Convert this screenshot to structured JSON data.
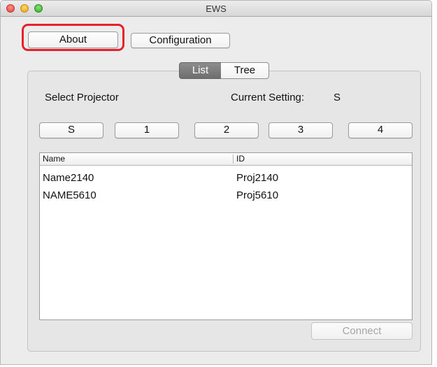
{
  "window": {
    "title": "EWS"
  },
  "toolbar": {
    "about_label": "About",
    "configuration_label": "Configuration"
  },
  "view_switch": {
    "options": [
      "List",
      "Tree"
    ],
    "selected": "List"
  },
  "select_projector": {
    "label": "Select Projector",
    "current_setting_label": "Current Setting:",
    "current_setting_value": "S",
    "buttons": [
      "S",
      "1",
      "2",
      "3",
      "4"
    ]
  },
  "table": {
    "columns": [
      "Name",
      "ID"
    ],
    "rows": [
      [
        "Name2140",
        "Proj2140"
      ],
      [
        "NAME5610",
        "Proj5610"
      ]
    ]
  },
  "connect_label": "Connect",
  "colors": {
    "highlight": "#e8202a",
    "segment_active": "#7d7d7d"
  }
}
